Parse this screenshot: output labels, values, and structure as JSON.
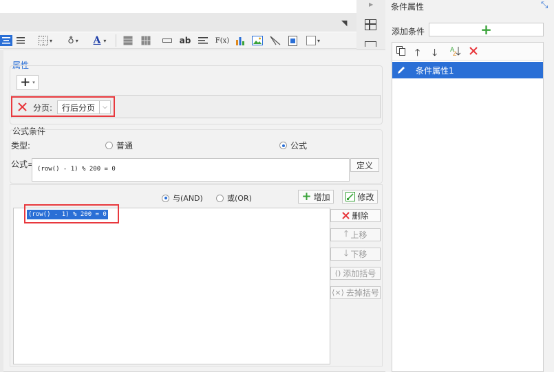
{
  "accent_color": "#2a6fd6",
  "highlight_color": "#e8383d",
  "toolbar": {
    "icons": [
      "align-center-icon",
      "align-justify-icon",
      "border-icon",
      "fill-color-icon",
      "font-color-icon",
      "insert-row-icon",
      "insert-column-icon",
      "field-icon",
      "text-ab-icon",
      "text-lines-icon",
      "formula-fx-icon",
      "chart-icon",
      "image-icon",
      "diagonal-line-icon",
      "sub-report-icon",
      "more-icon"
    ],
    "ab_label": "ab",
    "fx_label": "F(x)",
    "font_color_label": "A"
  },
  "dialog": {
    "properties_legend": "属性",
    "page_break": {
      "label": "分页:",
      "value": "行后分页"
    },
    "formula_condition_legend": "公式条件",
    "type_label": "类型:",
    "type_options": {
      "normal": "普通",
      "formula": "公式"
    },
    "formula_label": "公式=",
    "formula_value": "(row() - 1) % 200 = 0",
    "define_button": "定义",
    "logic": {
      "and": "与(AND)",
      "or": "或(OR)"
    },
    "add_button": "增加",
    "modify_button": "修改",
    "condition_item": "(row() - 1) % 200 = 0",
    "side_buttons": {
      "delete": "删除",
      "move_up": "上移",
      "move_down": "下移",
      "add_bracket": "添加括号",
      "remove_bracket": "去掉括号"
    }
  },
  "right_panel": {
    "title": "条件属性",
    "add_condition_label": "添加条件",
    "list_items": [
      "条件属性1"
    ]
  }
}
